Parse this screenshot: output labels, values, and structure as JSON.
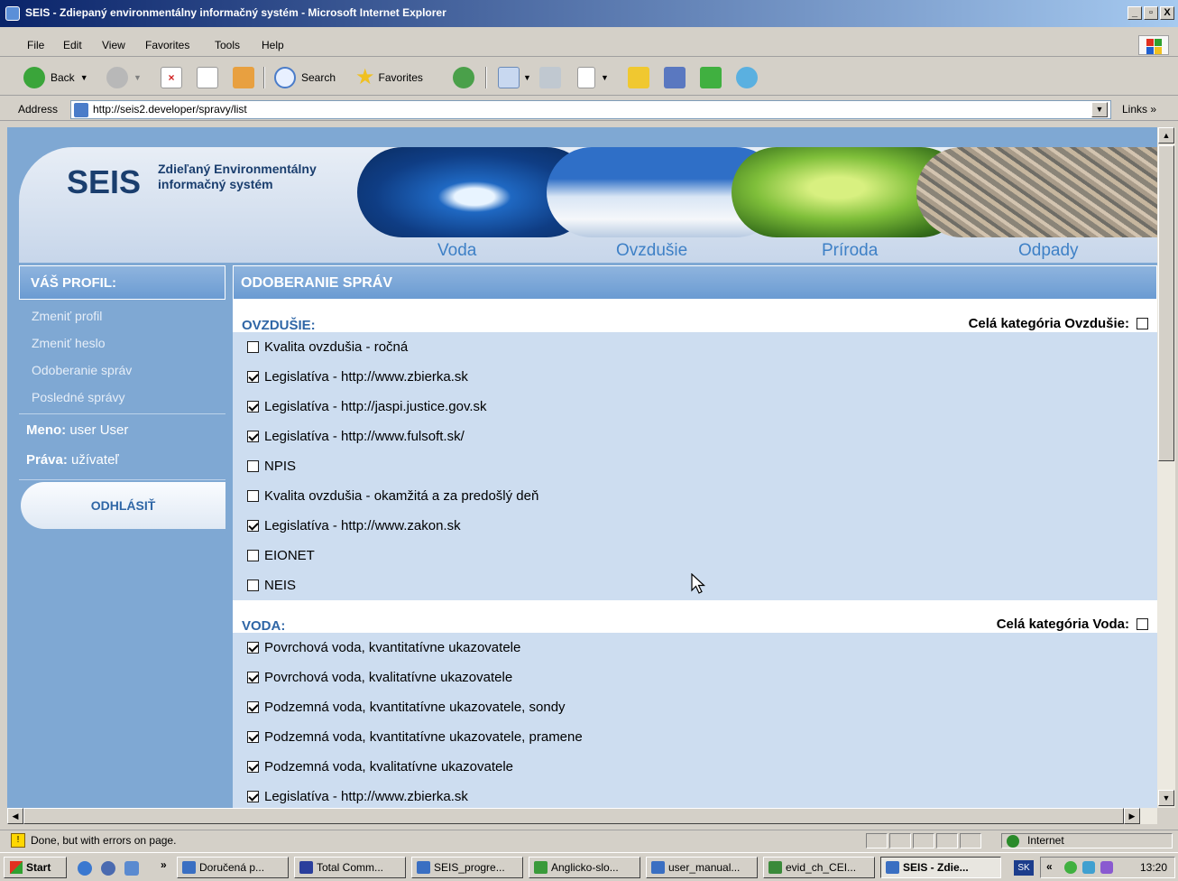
{
  "window": {
    "title": "SEIS - Zdiepaný environmentálny informačný systém - Microsoft Internet Explorer",
    "controls": [
      "_",
      "▫",
      "X"
    ]
  },
  "menu": [
    "File",
    "Edit",
    "View",
    "Favorites",
    "Tools",
    "Help"
  ],
  "toolbar": {
    "back_label": "Back",
    "search_label": "Search",
    "favorites_label": "Favorites"
  },
  "address": {
    "label": "Address",
    "url": "http://seis2.developer/spravy/list",
    "links_label": "Links"
  },
  "site": {
    "logo": "SEIS",
    "subtitle_line1": "Zdieľaný Environmentálny",
    "subtitle_line2": "informačný systém",
    "nav": [
      "Voda",
      "Ovzdušie",
      "Príroda",
      "Odpady"
    ]
  },
  "sidebar": {
    "heading": "VÁŠ PROFIL:",
    "links": [
      "Zmeniť profil",
      "Zmeniť heslo",
      "Odoberanie správ",
      "Posledné správy"
    ],
    "name_label": "Meno:",
    "name_value": "user User",
    "rights_label": "Práva:",
    "rights_value": "užívateľ",
    "logout": "ODHLÁSIŤ"
  },
  "main": {
    "heading": "ODOBERANIE SPRÁV",
    "categories": [
      {
        "name": "OVZDUŠIE:",
        "all_label": "Celá kategória Ovzdušie:",
        "all_checked": false,
        "items": [
          {
            "label": "Kvalita ovzdušia - ročná",
            "checked": false
          },
          {
            "label": "Legislatíva - http://www.zbierka.sk",
            "checked": true
          },
          {
            "label": "Legislatíva - http://jaspi.justice.gov.sk",
            "checked": true
          },
          {
            "label": "Legislatíva - http://www.fulsoft.sk/",
            "checked": true
          },
          {
            "label": "NPIS",
            "checked": false
          },
          {
            "label": "Kvalita ovzdušia - okamžitá a za predošlý deň",
            "checked": false
          },
          {
            "label": "Legislatíva - http://www.zakon.sk",
            "checked": true
          },
          {
            "label": "EIONET",
            "checked": false
          },
          {
            "label": "NEIS",
            "checked": false
          }
        ]
      },
      {
        "name": "VODA:",
        "all_label": "Celá kategória Voda:",
        "all_checked": false,
        "items": [
          {
            "label": "Povrchová voda, kvantitatívne ukazovatele",
            "checked": true
          },
          {
            "label": "Povrchová voda, kvalitatívne ukazovatele",
            "checked": true
          },
          {
            "label": "Podzemná voda, kvantitatívne ukazovatele, sondy",
            "checked": true
          },
          {
            "label": "Podzemná voda, kvantitatívne ukazovatele, pramene",
            "checked": true
          },
          {
            "label": "Podzemná voda, kvalitatívne ukazovatele",
            "checked": true
          },
          {
            "label": "Legislatíva - http://www.zbierka.sk",
            "checked": true
          }
        ]
      }
    ]
  },
  "status": {
    "text": "Done, but with errors on page.",
    "zone": "Internet"
  },
  "taskbar": {
    "start": "Start",
    "tasks": [
      "Doručená p...",
      "Total Comm...",
      "SEIS_progre...",
      "Anglicko-slo...",
      "user_manual...",
      "evid_ch_CEI...",
      "SEIS - Zdie..."
    ],
    "lang": "SK",
    "clock": "13:20"
  }
}
